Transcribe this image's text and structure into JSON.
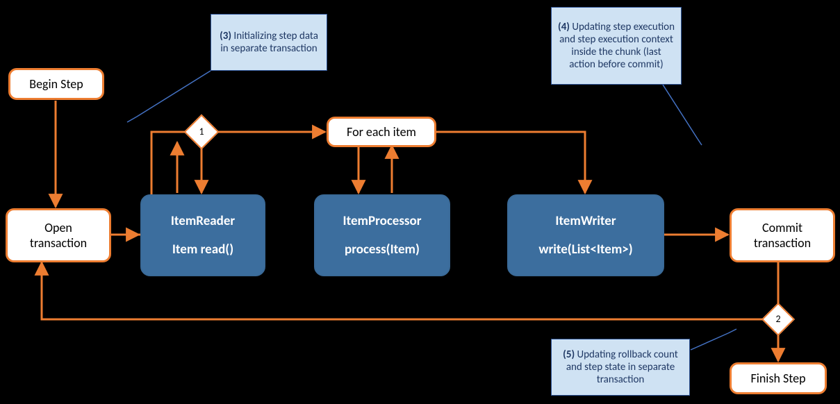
{
  "nodes": {
    "begin": "Begin Step",
    "open": "Open\ntransaction",
    "foreach": "For each item",
    "commit": "Commit\ntransaction",
    "finish": "Finish Step"
  },
  "components": {
    "reader": {
      "title": "ItemReader",
      "method": "Item read()"
    },
    "processor": {
      "title": "ItemProcessor",
      "method": "process(Item)"
    },
    "writer": {
      "title": "ItemWriter",
      "method": "write(List<Item>)"
    }
  },
  "notes": {
    "n3": {
      "num": "(3)",
      "text": " Initializing step data in separate transaction"
    },
    "n4": {
      "num": "(4)",
      "text": " Updating step execution and step execution context inside the chunk (last action before commit)"
    },
    "n5": {
      "num": "(5)",
      "text": " Updating rollback count and step state in separate transaction"
    }
  },
  "decisions": {
    "d1": "1",
    "d2": "2"
  }
}
